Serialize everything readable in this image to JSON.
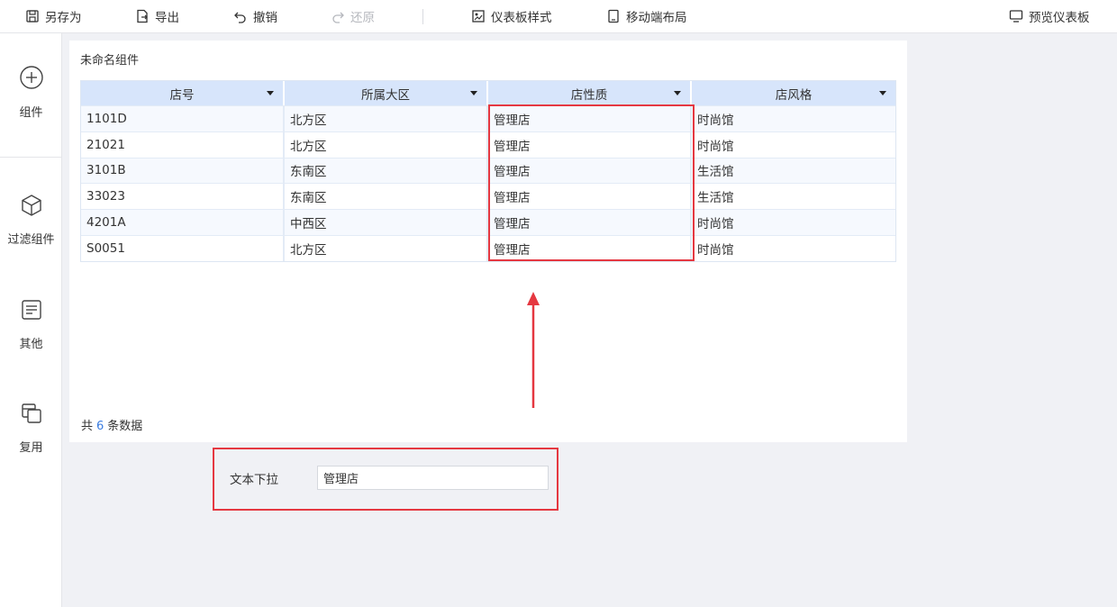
{
  "toolbar": {
    "save_as": "另存为",
    "export": "导出",
    "undo": "撤销",
    "redo": "还原",
    "dashboard_style": "仪表板样式",
    "mobile_layout": "移动端布局",
    "preview": "预览仪表板"
  },
  "sidebar": {
    "items": [
      {
        "label": "组件",
        "icon": "plus-circle-icon"
      },
      {
        "label": "过滤组件",
        "icon": "cube-icon"
      },
      {
        "label": "其他",
        "icon": "document-icon"
      },
      {
        "label": "复用",
        "icon": "copy-icon"
      }
    ]
  },
  "widget": {
    "title": "未命名组件",
    "columns": [
      "店号",
      "所属大区",
      "店性质",
      "店风格"
    ],
    "rows": [
      [
        "1101D",
        "北方区",
        "管理店",
        "时尚馆"
      ],
      [
        "21021",
        "北方区",
        "管理店",
        "时尚馆"
      ],
      [
        "3101B",
        "东南区",
        "管理店",
        "生活馆"
      ],
      [
        "33023",
        "东南区",
        "管理店",
        "生活馆"
      ],
      [
        "4201A",
        "中西区",
        "管理店",
        "时尚馆"
      ],
      [
        "S0051",
        "北方区",
        "管理店",
        "时尚馆"
      ]
    ],
    "count_prefix": "共",
    "count_value": "6",
    "count_suffix": "条数据"
  },
  "filter": {
    "label": "文本下拉",
    "value": "管理店"
  },
  "colors": {
    "highlight": "#e53841",
    "header_bg": "#d7e5fb",
    "accent": "#3a7ce0"
  }
}
